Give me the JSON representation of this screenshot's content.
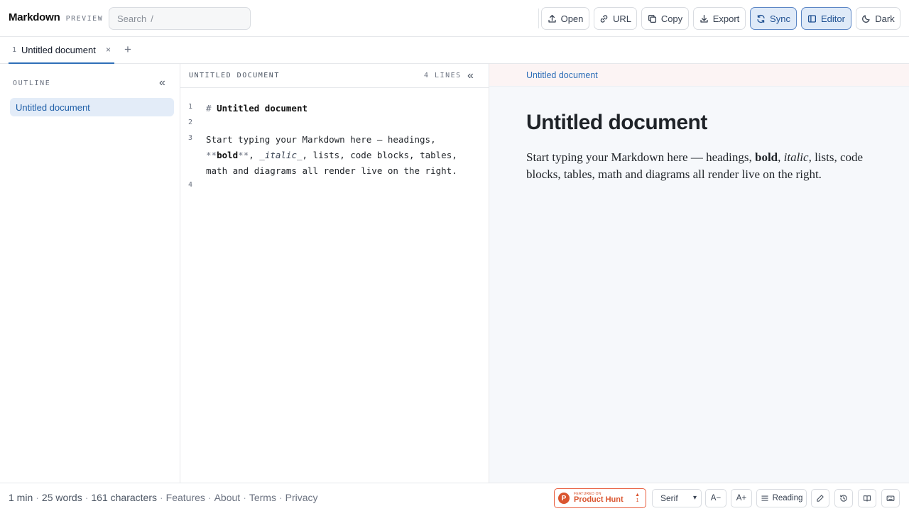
{
  "header": {
    "brand": "Markdown",
    "brand_tag": "PREVIEW",
    "search": {
      "placeholder": "Search",
      "shortcut": "/"
    },
    "buttons": {
      "open": "Open",
      "url": "URL",
      "copy": "Copy",
      "export": "Export",
      "sync": "Sync",
      "editor": "Editor",
      "dark": "Dark"
    },
    "active_buttons": [
      "Sync",
      "Editor"
    ]
  },
  "tabs": [
    {
      "number": "1",
      "title": "Untitled document",
      "close": "×"
    }
  ],
  "tab_add": "+",
  "outline": {
    "title": "OUTLINE",
    "collapse": "«",
    "items": [
      "Untitled document"
    ]
  },
  "editor": {
    "title": "UNTITLED DOCUMENT",
    "line_count": "4 LINES",
    "collapse": "«",
    "line_numbers": [
      "1",
      "2",
      "3",
      "4"
    ],
    "lines": {
      "l1_hash": "# ",
      "l1_text": "Untitled document",
      "l3_a": "Start typing your Markdown here — headings,",
      "l3_b_open": "**",
      "l3_b_bold": "bold",
      "l3_b_close": "**",
      "l3_b_sep": ", ",
      "l3_b_em": "_italic_",
      "l3_b_rest": ", lists, code blocks, tables,",
      "l3_c": "math and diagrams all render live on the right."
    }
  },
  "preview": {
    "breadcrumb": "Untitled document",
    "heading": "Untitled document",
    "para_a": "Start typing your Markdown here — headings, ",
    "para_bold": "bold",
    "para_sep": ", ",
    "para_em": "italic",
    "para_rest": ", lists, code blocks, tables, math and diagrams all render live on the right."
  },
  "footer": {
    "read_time": "1 min",
    "words": "25 words",
    "characters": "161 characters",
    "links": [
      "Features",
      "About",
      "Terms",
      "Privacy"
    ],
    "product_hunt": {
      "small": "FEATURED ON",
      "label": "Product Hunt",
      "votes": "1",
      "arrow": "▲"
    },
    "font_select": "Serif",
    "font_decrease": "A−",
    "font_increase": "A+",
    "reading": "Reading"
  },
  "colors": {
    "accent": "#2f6fb8",
    "active_bg": "#dfeaf8",
    "product_hunt": "#da552f",
    "preview_bg": "#f6f8fb"
  },
  "icons": {
    "open": "upload-icon",
    "url": "link-icon",
    "copy": "copy-icon",
    "export": "download-icon",
    "sync": "sync-icon",
    "editor": "panel-icon",
    "dark": "moon-icon"
  }
}
